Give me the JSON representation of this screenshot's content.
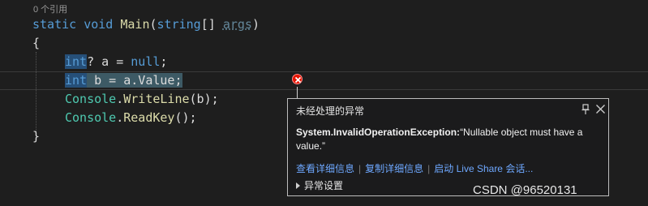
{
  "editor": {
    "codelens": "0 个引用",
    "line1": {
      "kw1": "static",
      "kw2": "void",
      "method": "Main",
      "p1": "(",
      "type": "string",
      "p2": "[] ",
      "param": "args",
      "p3": ")"
    },
    "line2": "{",
    "line3": {
      "kw": "int",
      "rest1": "? a = ",
      "kw2": "null",
      "rest2": ";"
    },
    "line4": {
      "kw": "int",
      "rest": " b = a.Value;"
    },
    "line5": {
      "type": "Console",
      "dot": ".",
      "method": "WriteLine",
      "args": "(b);"
    },
    "line6": {
      "type": "Console",
      "dot": ".",
      "method": "ReadKey",
      "args": "();"
    },
    "line7": "}"
  },
  "exception_popup": {
    "title": "未经处理的异常",
    "exception_name": "System.InvalidOperationException:",
    "message": "“Nullable object must have a value.”",
    "actions": [
      "查看详细信息",
      "复制详细信息",
      "启动 Live Share 会话..."
    ],
    "settings_label": "异常设置"
  },
  "watermark": "CSDN @96520131",
  "icons": {
    "pin": "pin-icon",
    "close": "close-icon",
    "error": "error-icon",
    "expander": "expander-icon"
  },
  "colors": {
    "background": "#1e1e1e",
    "keyword": "#569cd6",
    "type": "#4ec9b0",
    "method": "#dcdcaa",
    "link": "#6ea8ff",
    "error": "#e51400"
  }
}
